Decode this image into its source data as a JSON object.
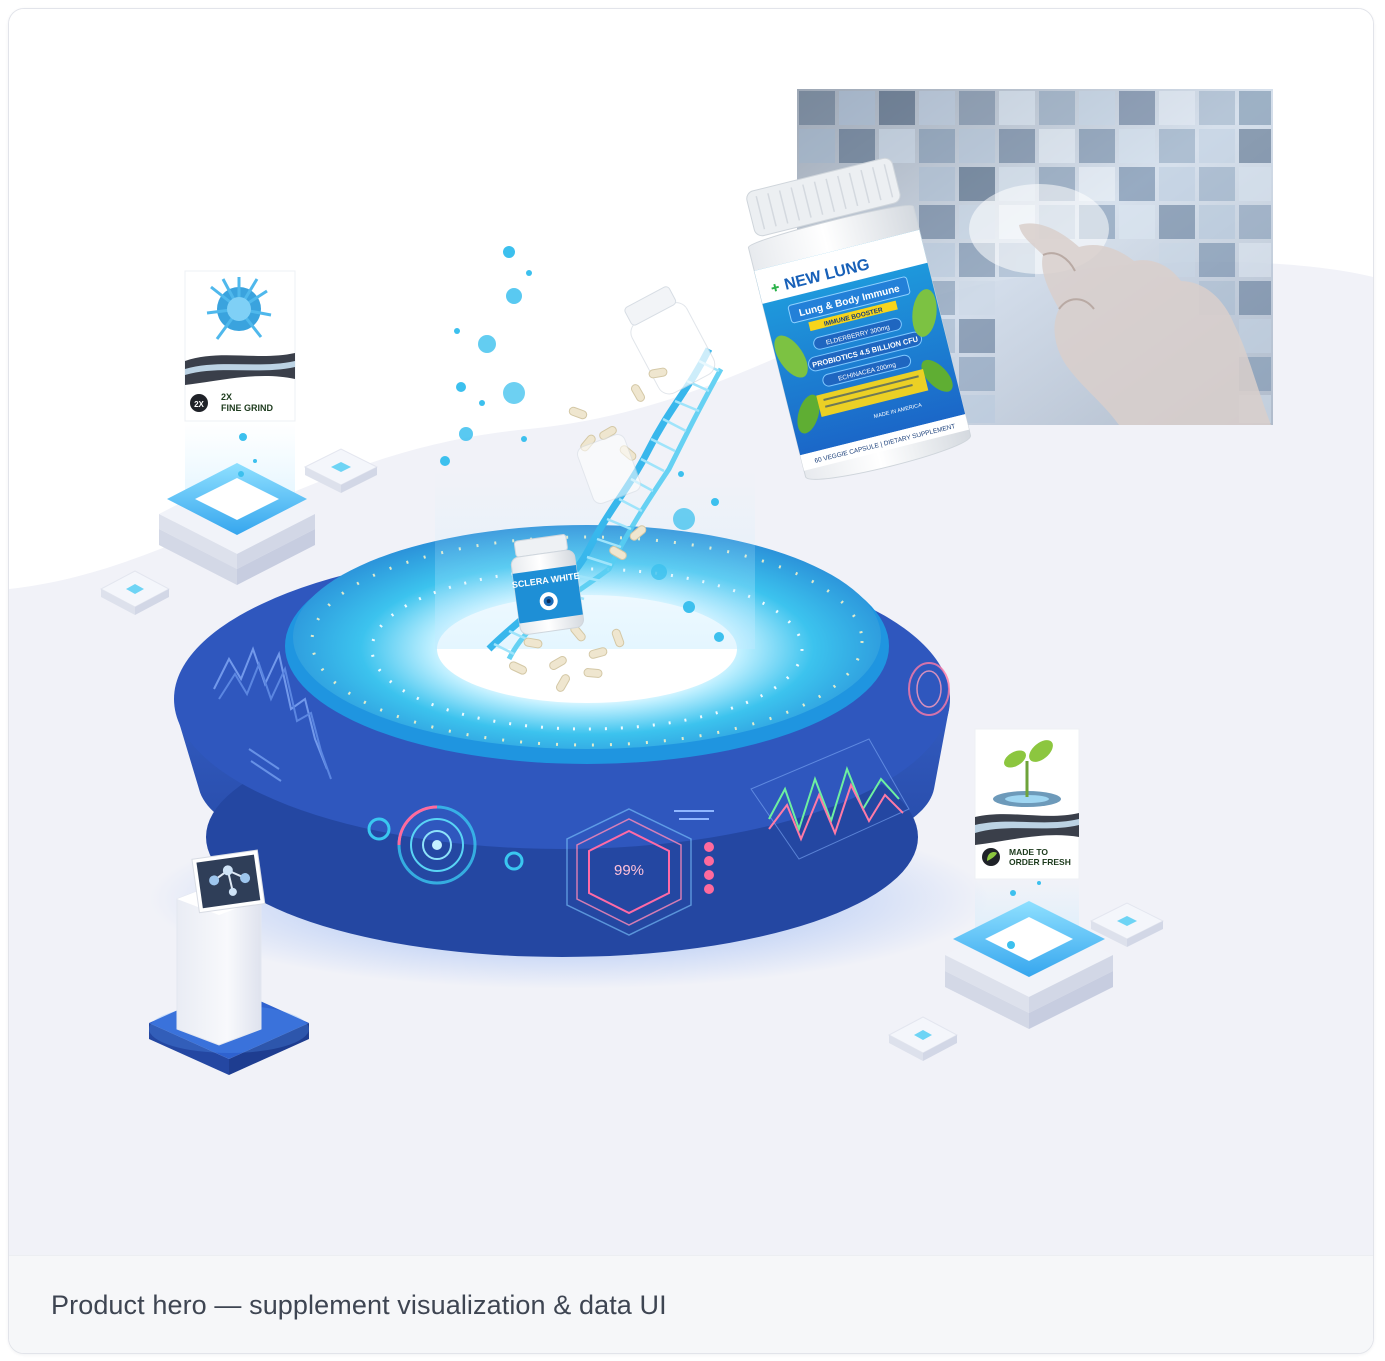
{
  "caption": "Product hero — supplement visualization & data UI",
  "colors": {
    "brand_blue": "#2f54b8",
    "deep_blue": "#2346a0",
    "cyan": "#33c2ec",
    "bg_wave": "#eef0f6",
    "caption_text": "#3e4552"
  },
  "bottle_main": {
    "brand": "NEW LUNG",
    "product": "Lung & Body Immune",
    "tagline": "IMMUNE BOOSTER",
    "line1": "ELDERBERRY 300mg",
    "line2": "PROBIOTICS 4.5 BILLION CFU",
    "line3": "ECHINACEA 200mg",
    "footer": "60 VEGGIE CAPSULE | DIETARY SUPPLEMENT",
    "origin": "MADE IN AMERICA"
  },
  "bottle_small": {
    "brand": "SCLERA WHITE"
  },
  "feature_left": {
    "badge": "2X",
    "label_line1": "2X",
    "label_line2": "FINE GRIND"
  },
  "feature_right": {
    "label_line1": "MADE TO",
    "label_line2": "ORDER FRESH"
  },
  "platform": {
    "percent": "99%"
  },
  "icons": {
    "molecule": "molecule-icon",
    "splash": "splash-icon",
    "sprout": "sprout-icon",
    "dna": "dna-helix-icon",
    "hand": "hand-pointer-icon"
  }
}
